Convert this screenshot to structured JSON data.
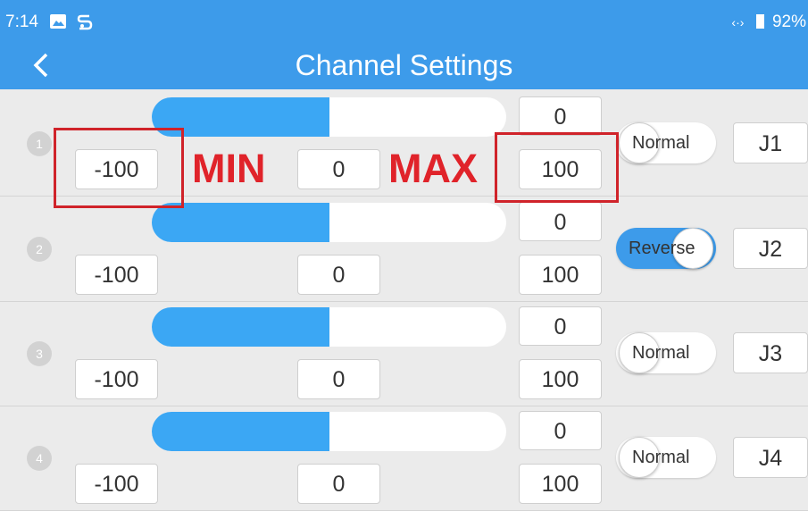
{
  "status_bar": {
    "time": "7:14",
    "image_icon": "image-icon",
    "app_icon": "app-s-icon",
    "network_icon": "network-arrows-icon",
    "battery_icon": "battery-icon",
    "battery": "92%"
  },
  "header": {
    "back_icon": "back-arrow-icon",
    "title": "Channel Settings"
  },
  "annotations": {
    "min_label": "MIN",
    "max_label": "MAX"
  },
  "channels": [
    {
      "number": "1",
      "min": "-100",
      "center": "0",
      "max_top": "0",
      "max": "100",
      "toggle": "Normal",
      "control": "J1",
      "fill": 0.5,
      "reverse": false
    },
    {
      "number": "2",
      "min": "-100",
      "center": "0",
      "max_top": "0",
      "max": "100",
      "toggle": "Reverse",
      "control": "J2",
      "fill": 0.5,
      "reverse": true
    },
    {
      "number": "3",
      "min": "-100",
      "center": "0",
      "max_top": "0",
      "max": "100",
      "toggle": "Normal",
      "control": "J3",
      "fill": 0.5,
      "reverse": false
    },
    {
      "number": "4",
      "min": "-100",
      "center": "0",
      "max_top": "0",
      "max": "100",
      "toggle": "Normal",
      "control": "J4",
      "fill": 0.5,
      "reverse": false
    }
  ],
  "colors": {
    "accent": "#3d9bea",
    "fill": "#3ba7f4",
    "annotation_red": "#d0232a"
  }
}
